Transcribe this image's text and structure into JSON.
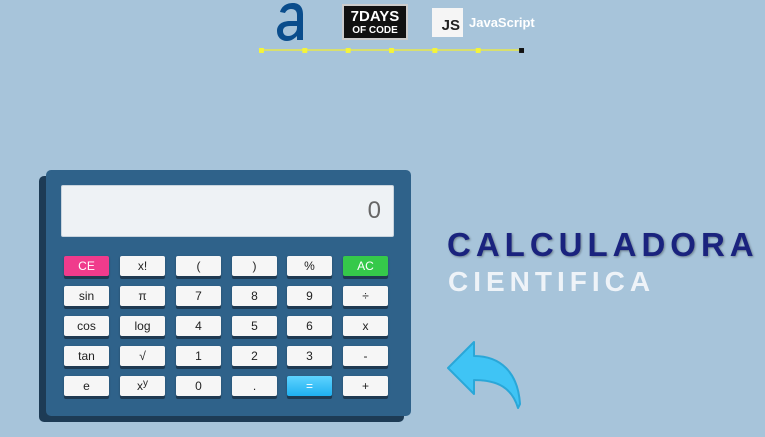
{
  "header": {
    "logo_a": "a",
    "logo_7days_line1": "7DAYS",
    "logo_7days_line2": "OF CODE",
    "logo_js_box": "JS",
    "logo_js_text": "JavaScript",
    "progress_steps": 7
  },
  "calculator": {
    "display_value": "0",
    "keys": [
      {
        "label": "CE",
        "kind": "ce"
      },
      {
        "label": "x!",
        "kind": "normal"
      },
      {
        "label": "(",
        "kind": "normal"
      },
      {
        "label": ")",
        "kind": "normal"
      },
      {
        "label": "%",
        "kind": "normal"
      },
      {
        "label": "AC",
        "kind": "ac"
      },
      {
        "label": "sin",
        "kind": "normal"
      },
      {
        "label": "π",
        "kind": "normal"
      },
      {
        "label": "7",
        "kind": "normal"
      },
      {
        "label": "8",
        "kind": "normal"
      },
      {
        "label": "9",
        "kind": "normal"
      },
      {
        "label": "÷",
        "kind": "normal"
      },
      {
        "label": "cos",
        "kind": "normal"
      },
      {
        "label": "log",
        "kind": "normal"
      },
      {
        "label": "4",
        "kind": "normal"
      },
      {
        "label": "5",
        "kind": "normal"
      },
      {
        "label": "6",
        "kind": "normal"
      },
      {
        "label": "x",
        "kind": "normal"
      },
      {
        "label": "tan",
        "kind": "normal"
      },
      {
        "label": "√",
        "kind": "normal"
      },
      {
        "label": "1",
        "kind": "normal"
      },
      {
        "label": "2",
        "kind": "normal"
      },
      {
        "label": "3",
        "kind": "normal"
      },
      {
        "label": "-",
        "kind": "normal"
      },
      {
        "label": "e",
        "kind": "normal"
      },
      {
        "label": "x",
        "sup": "y",
        "kind": "normal"
      },
      {
        "label": "0",
        "kind": "normal"
      },
      {
        "label": ".",
        "kind": "normal"
      },
      {
        "label": "=",
        "kind": "eq"
      },
      {
        "label": "+",
        "kind": "normal"
      }
    ]
  },
  "title": {
    "line1": "CALCULADORA",
    "line2": "CIENTIFICA"
  },
  "colors": {
    "background": "#a7c4da",
    "calculator_body": "#2f628a",
    "ce_key": "#f03b8c",
    "ac_key": "#35c94a",
    "equals_key": "#1fb0f0",
    "title_primary": "#1a237e",
    "arrow": "#3fc4f5"
  },
  "icons": {
    "back": "back-arrow-icon"
  }
}
